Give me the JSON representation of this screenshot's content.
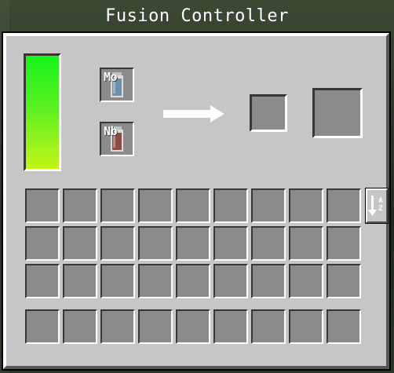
{
  "window": {
    "title": "Fusion Controller"
  },
  "energy": {
    "fill_fraction": 1.0,
    "colors": {
      "top": "#16f51b",
      "bottom": "#c3f518"
    }
  },
  "inputs": [
    {
      "label": "Mo",
      "item": "molybdenum-cell",
      "color": "#6f8fa6"
    },
    {
      "label": "Nb",
      "item": "niobium-cell",
      "color": "#8a4d45"
    }
  ],
  "progress": {
    "fraction": 1.0,
    "icon": "progress-arrow-icon"
  },
  "sort_button": {
    "icon": "sort-az-icon",
    "label": "AZ"
  },
  "inventory": {
    "rows": 3,
    "cols": 9
  },
  "hotbar": {
    "cols": 9
  }
}
